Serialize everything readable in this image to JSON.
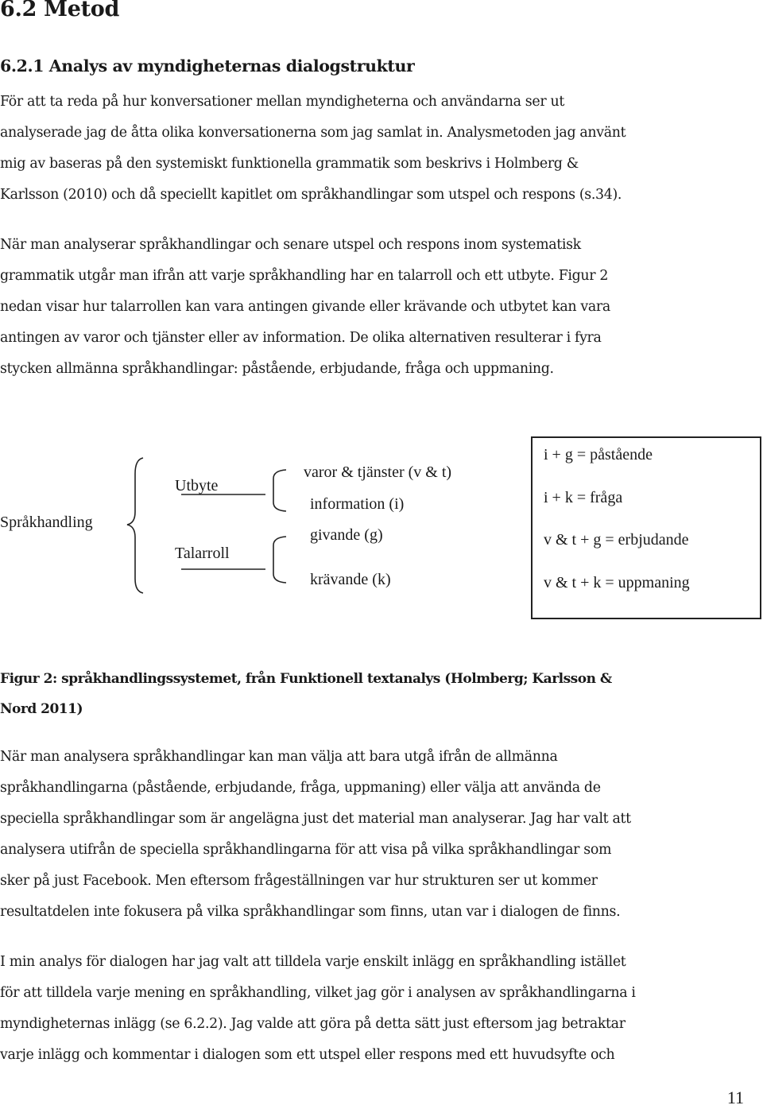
{
  "heading": "6.2 Metod",
  "subheading": "6.2.1 Analys av myndigheternas dialogstruktur",
  "paragraphs": [
    {
      "lines": [
        "För att ta reda på hur konversationer mellan myndigheterna och användarna ser ut",
        "analyserade jag de åtta olika konversationerna som jag samlat in. Analysmetoden jag använt",
        "mig av baseras på den systemiskt funktionella grammatik som beskrivs i Holmberg &",
        "Karlsson (2010) och då speciellt kapitlet om språkhandlingar som utspel och respons (s.34)."
      ]
    },
    {
      "lines": [
        "När man analyserar språkhandlingar och senare utspel och respons inom systematisk",
        "grammatik utgår man ifrån att varje språkhandling har en talarroll och ett utbyte. Figur 2",
        "nedan visar hur talarrollen kan vara antingen givande eller krävande och utbytet kan vara",
        "antingen av varor och tjänster eller av information.  De olika alternativen resulterar i fyra",
        "stycken allmänna språkhandlingar: påstående, erbjudande, fråga och uppmaning."
      ]
    },
    {
      "lines": [
        "När man analysera språkhandlingar kan man välja att bara utgå ifrån de allmänna",
        "språkhandlingarna (påstående, erbjudande, fråga, uppmaning) eller välja att använda de",
        "speciella språkhandlingar som är angelägna just det material man analyserar. Jag har valt att",
        "analysera utifrån de speciella språkhandlingarna för att visa på vilka språkhandlingar som",
        "sker på just Facebook. Men eftersom frågeställningen var hur strukturen ser ut kommer",
        "resultatdelen inte fokusera på vilka språkhandlingar som finns, utan var i dialogen de finns."
      ]
    },
    {
      "lines": [
        "I min analys för dialogen har jag valt att tilldela varje enskilt inlägg en språkhandling istället",
        "för att tilldela varje mening en språkhandling, vilket jag gör i analysen av språkhandlingarna i",
        "myndigheternas inlägg (se 6.2.2).  Jag valde att göra på detta sätt just eftersom jag betraktar",
        "varje inlägg och kommentar i dialogen som ett utspel eller respons med ett huvudsyfte och"
      ]
    }
  ],
  "figure": {
    "root": "Språkhandling",
    "branches": [
      {
        "label": "Utbyte",
        "options": [
          "varor & tjänster (v & t)",
          "information (i)"
        ]
      },
      {
        "label": "Talarroll",
        "options": [
          "givande (g)",
          "krävande (k)"
        ]
      }
    ],
    "results": [
      "i + g = påstående",
      "i + k = fråga",
      "v & t + g = erbjudande",
      "v & t + k = uppmaning"
    ],
    "caption_lines": [
      "Figur 2: språkhandlingssystemet, från Funktionell textanalys (Holmberg; Karlsson &",
      "Nord 2011)"
    ]
  },
  "page_number": "11"
}
